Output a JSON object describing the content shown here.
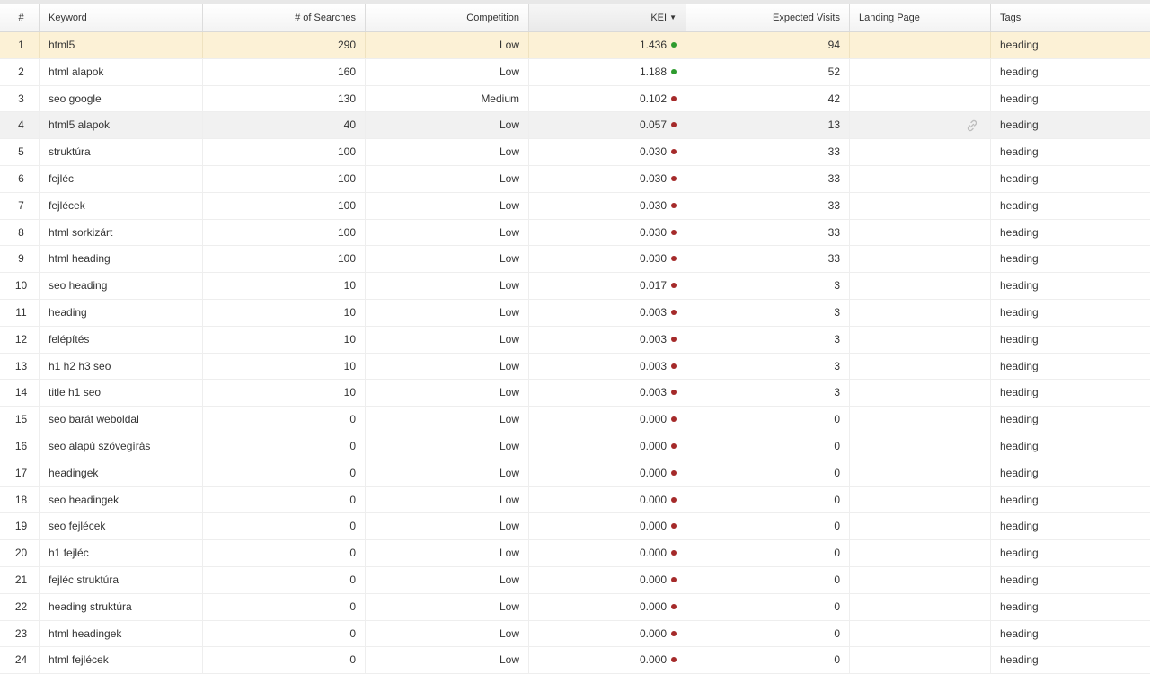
{
  "colors": {
    "good": "#2e9b2e",
    "bad": "#a52a2a",
    "selected_row": "#fcf1d6",
    "hover_row": "#f1f1f1"
  },
  "columns": {
    "num": "#",
    "keyword": "Keyword",
    "searches": "# of Searches",
    "competition": "Competition",
    "kei": "KEI",
    "visits": "Expected Visits",
    "landing": "Landing Page",
    "tags": "Tags"
  },
  "sort": {
    "column": "kei",
    "direction": "descending"
  },
  "rows": [
    {
      "num": "1",
      "keyword": "html5",
      "searches": "290",
      "competition": "Low",
      "kei": "1.436",
      "status": "good",
      "visits": "94",
      "landing": "",
      "tags": "heading",
      "state": "selected"
    },
    {
      "num": "2",
      "keyword": "html alapok",
      "searches": "160",
      "competition": "Low",
      "kei": "1.188",
      "status": "good",
      "visits": "52",
      "landing": "",
      "tags": "heading",
      "state": ""
    },
    {
      "num": "3",
      "keyword": "seo google",
      "searches": "130",
      "competition": "Medium",
      "kei": "0.102",
      "status": "bad",
      "visits": "42",
      "landing": "",
      "tags": "heading",
      "state": ""
    },
    {
      "num": "4",
      "keyword": "html5 alapok",
      "searches": "40",
      "competition": "Low",
      "kei": "0.057",
      "status": "bad",
      "visits": "13",
      "landing": "",
      "tags": "heading",
      "state": "hovered",
      "show_link_icon": true
    },
    {
      "num": "5",
      "keyword": "struktúra",
      "searches": "100",
      "competition": "Low",
      "kei": "0.030",
      "status": "bad",
      "visits": "33",
      "landing": "",
      "tags": "heading",
      "state": ""
    },
    {
      "num": "6",
      "keyword": "fejléc",
      "searches": "100",
      "competition": "Low",
      "kei": "0.030",
      "status": "bad",
      "visits": "33",
      "landing": "",
      "tags": "heading",
      "state": ""
    },
    {
      "num": "7",
      "keyword": "fejlécek",
      "searches": "100",
      "competition": "Low",
      "kei": "0.030",
      "status": "bad",
      "visits": "33",
      "landing": "",
      "tags": "heading",
      "state": ""
    },
    {
      "num": "8",
      "keyword": "html sorkizárt",
      "searches": "100",
      "competition": "Low",
      "kei": "0.030",
      "status": "bad",
      "visits": "33",
      "landing": "",
      "tags": "heading",
      "state": ""
    },
    {
      "num": "9",
      "keyword": "html heading",
      "searches": "100",
      "competition": "Low",
      "kei": "0.030",
      "status": "bad",
      "visits": "33",
      "landing": "",
      "tags": "heading",
      "state": ""
    },
    {
      "num": "10",
      "keyword": "seo heading",
      "searches": "10",
      "competition": "Low",
      "kei": "0.017",
      "status": "bad",
      "visits": "3",
      "landing": "",
      "tags": "heading",
      "state": ""
    },
    {
      "num": "11",
      "keyword": "heading",
      "searches": "10",
      "competition": "Low",
      "kei": "0.003",
      "status": "bad",
      "visits": "3",
      "landing": "",
      "tags": "heading",
      "state": ""
    },
    {
      "num": "12",
      "keyword": "felépítés",
      "searches": "10",
      "competition": "Low",
      "kei": "0.003",
      "status": "bad",
      "visits": "3",
      "landing": "",
      "tags": "heading",
      "state": ""
    },
    {
      "num": "13",
      "keyword": "h1 h2 h3 seo",
      "searches": "10",
      "competition": "Low",
      "kei": "0.003",
      "status": "bad",
      "visits": "3",
      "landing": "",
      "tags": "heading",
      "state": ""
    },
    {
      "num": "14",
      "keyword": "title h1 seo",
      "searches": "10",
      "competition": "Low",
      "kei": "0.003",
      "status": "bad",
      "visits": "3",
      "landing": "",
      "tags": "heading",
      "state": ""
    },
    {
      "num": "15",
      "keyword": "seo barát weboldal",
      "searches": "0",
      "competition": "Low",
      "kei": "0.000",
      "status": "bad",
      "visits": "0",
      "landing": "",
      "tags": "heading",
      "state": ""
    },
    {
      "num": "16",
      "keyword": "seo alapú szövegírás",
      "searches": "0",
      "competition": "Low",
      "kei": "0.000",
      "status": "bad",
      "visits": "0",
      "landing": "",
      "tags": "heading",
      "state": ""
    },
    {
      "num": "17",
      "keyword": "headingek",
      "searches": "0",
      "competition": "Low",
      "kei": "0.000",
      "status": "bad",
      "visits": "0",
      "landing": "",
      "tags": "heading",
      "state": ""
    },
    {
      "num": "18",
      "keyword": "seo headingek",
      "searches": "0",
      "competition": "Low",
      "kei": "0.000",
      "status": "bad",
      "visits": "0",
      "landing": "",
      "tags": "heading",
      "state": ""
    },
    {
      "num": "19",
      "keyword": "seo fejlécek",
      "searches": "0",
      "competition": "Low",
      "kei": "0.000",
      "status": "bad",
      "visits": "0",
      "landing": "",
      "tags": "heading",
      "state": ""
    },
    {
      "num": "20",
      "keyword": "h1 fejléc",
      "searches": "0",
      "competition": "Low",
      "kei": "0.000",
      "status": "bad",
      "visits": "0",
      "landing": "",
      "tags": "heading",
      "state": ""
    },
    {
      "num": "21",
      "keyword": "fejléc struktúra",
      "searches": "0",
      "competition": "Low",
      "kei": "0.000",
      "status": "bad",
      "visits": "0",
      "landing": "",
      "tags": "heading",
      "state": ""
    },
    {
      "num": "22",
      "keyword": "heading struktúra",
      "searches": "0",
      "competition": "Low",
      "kei": "0.000",
      "status": "bad",
      "visits": "0",
      "landing": "",
      "tags": "heading",
      "state": ""
    },
    {
      "num": "23",
      "keyword": "html headingek",
      "searches": "0",
      "competition": "Low",
      "kei": "0.000",
      "status": "bad",
      "visits": "0",
      "landing": "",
      "tags": "heading",
      "state": ""
    },
    {
      "num": "24",
      "keyword": "html fejlécek",
      "searches": "0",
      "competition": "Low",
      "kei": "0.000",
      "status": "bad",
      "visits": "0",
      "landing": "",
      "tags": "heading",
      "state": ""
    }
  ]
}
